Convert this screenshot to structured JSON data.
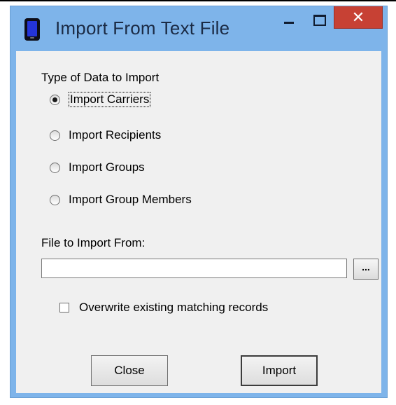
{
  "window": {
    "title": "Import From Text File",
    "close_glyph": "✕"
  },
  "import_type": {
    "label": "Type of Data to Import",
    "options": [
      {
        "label": "Import Carriers",
        "selected": true
      },
      {
        "label": "Import Recipients",
        "selected": false
      },
      {
        "label": "Import Groups",
        "selected": false
      },
      {
        "label": "Import Group Members",
        "selected": false
      }
    ]
  },
  "file": {
    "label": "File to Import From:",
    "value": "",
    "browse_label": "..."
  },
  "overwrite": {
    "label": "Overwrite existing matching records",
    "checked": false
  },
  "buttons": {
    "close_label": "Close",
    "import_label": "Import"
  },
  "colors": {
    "title_bar": "#7eb4ea",
    "close_button": "#c74134",
    "client": "#f0f0f0"
  },
  "icons": {
    "app": "mobile-phone-icon",
    "minimize": "minimize-icon",
    "maximize": "maximize-icon",
    "close": "close-icon"
  }
}
